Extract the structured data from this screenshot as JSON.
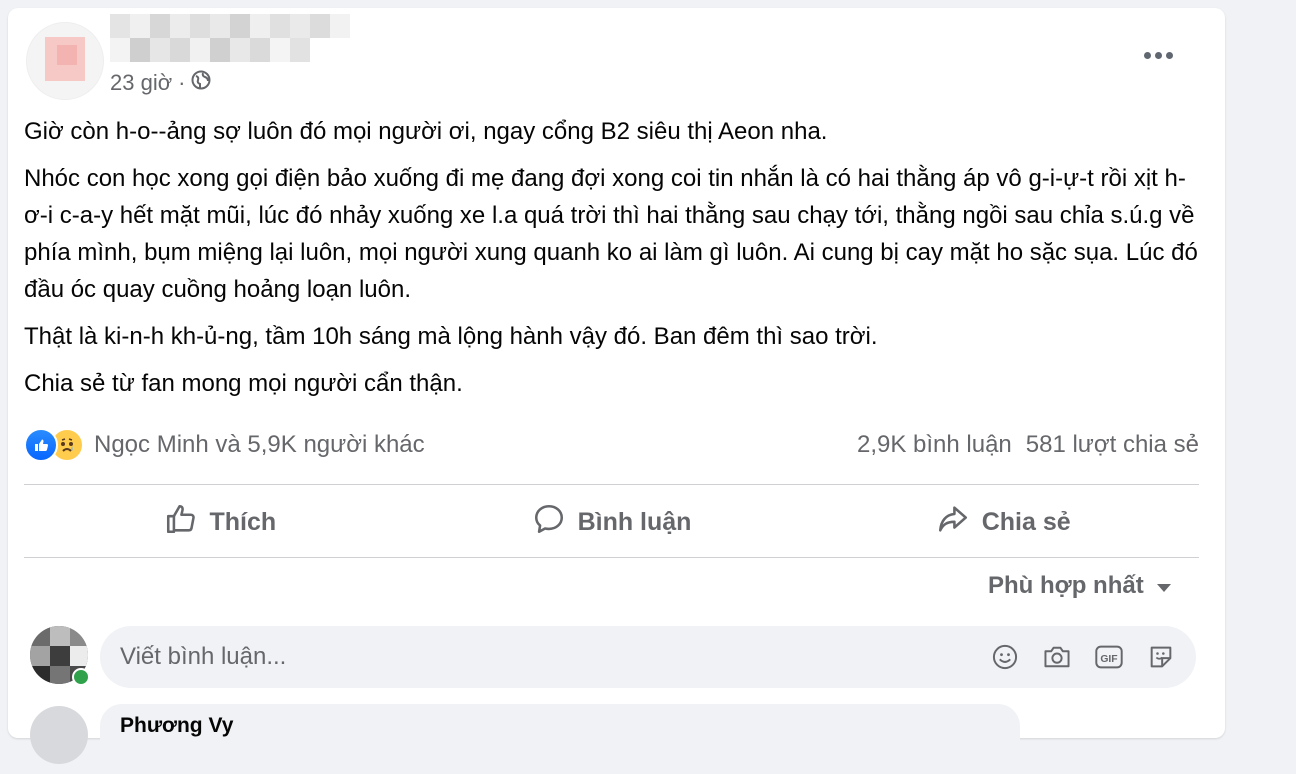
{
  "post": {
    "time": "23 giờ",
    "separator": "·",
    "privacy_icon": "globe-icon",
    "more_icon": "more-horizontal-icon",
    "paragraphs": [
      "Giờ còn h-o--ảng sợ luôn đó mọi người ơi, ngay cổng B2 siêu thị Aeon nha.",
      "Nhóc con học xong gọi điện bảo xuống đi mẹ đang đợi xong coi tin nhắn là có hai thằng áp vô g-i-ự-t rồi xịt h-ơ-i c-a-y hết mặt mũi, lúc đó nhảy xuống xe l.a quá trời thì hai thằng sau chạy tới, thằng ngồi sau chỉa s.ú.g về phía mình, bụm miệng lại luôn, mọi người xung quanh ko ai làm gì luôn. Ai cung bị cay mặt ho sặc sụa. Lúc đó đầu óc quay cuồng hoảng loạn luôn.",
      "Thật là ki-n-h kh-ủ-ng, tầm 10h sáng mà lộng hành vậy đó. Ban đêm thì sao trời.",
      "Chia sẻ từ fan mong mọi người cẩn thận."
    ]
  },
  "reactions": {
    "icons": [
      "like-reaction-icon",
      "sad-reaction-icon"
    ],
    "summary": "Ngọc Minh và 5,9K người khác",
    "comments": "2,9K bình luận",
    "shares": "581 lượt chia sẻ"
  },
  "actions": {
    "like": "Thích",
    "comment": "Bình luận",
    "share": "Chia sẻ"
  },
  "sort": {
    "label": "Phù hợp nhất"
  },
  "comment_box": {
    "placeholder": "Viết bình luận...",
    "tools": [
      "emoji-icon",
      "camera-icon",
      "gif-icon",
      "sticker-icon"
    ],
    "gif_label": "GIF"
  },
  "next_comment": {
    "name_partial": "Phương Vy"
  },
  "colors": {
    "background": "#f0f2f5",
    "card": "#ffffff",
    "text_primary": "#050505",
    "text_secondary": "#65676b",
    "like_blue": "#0866ff",
    "divider": "#ced0d4"
  }
}
